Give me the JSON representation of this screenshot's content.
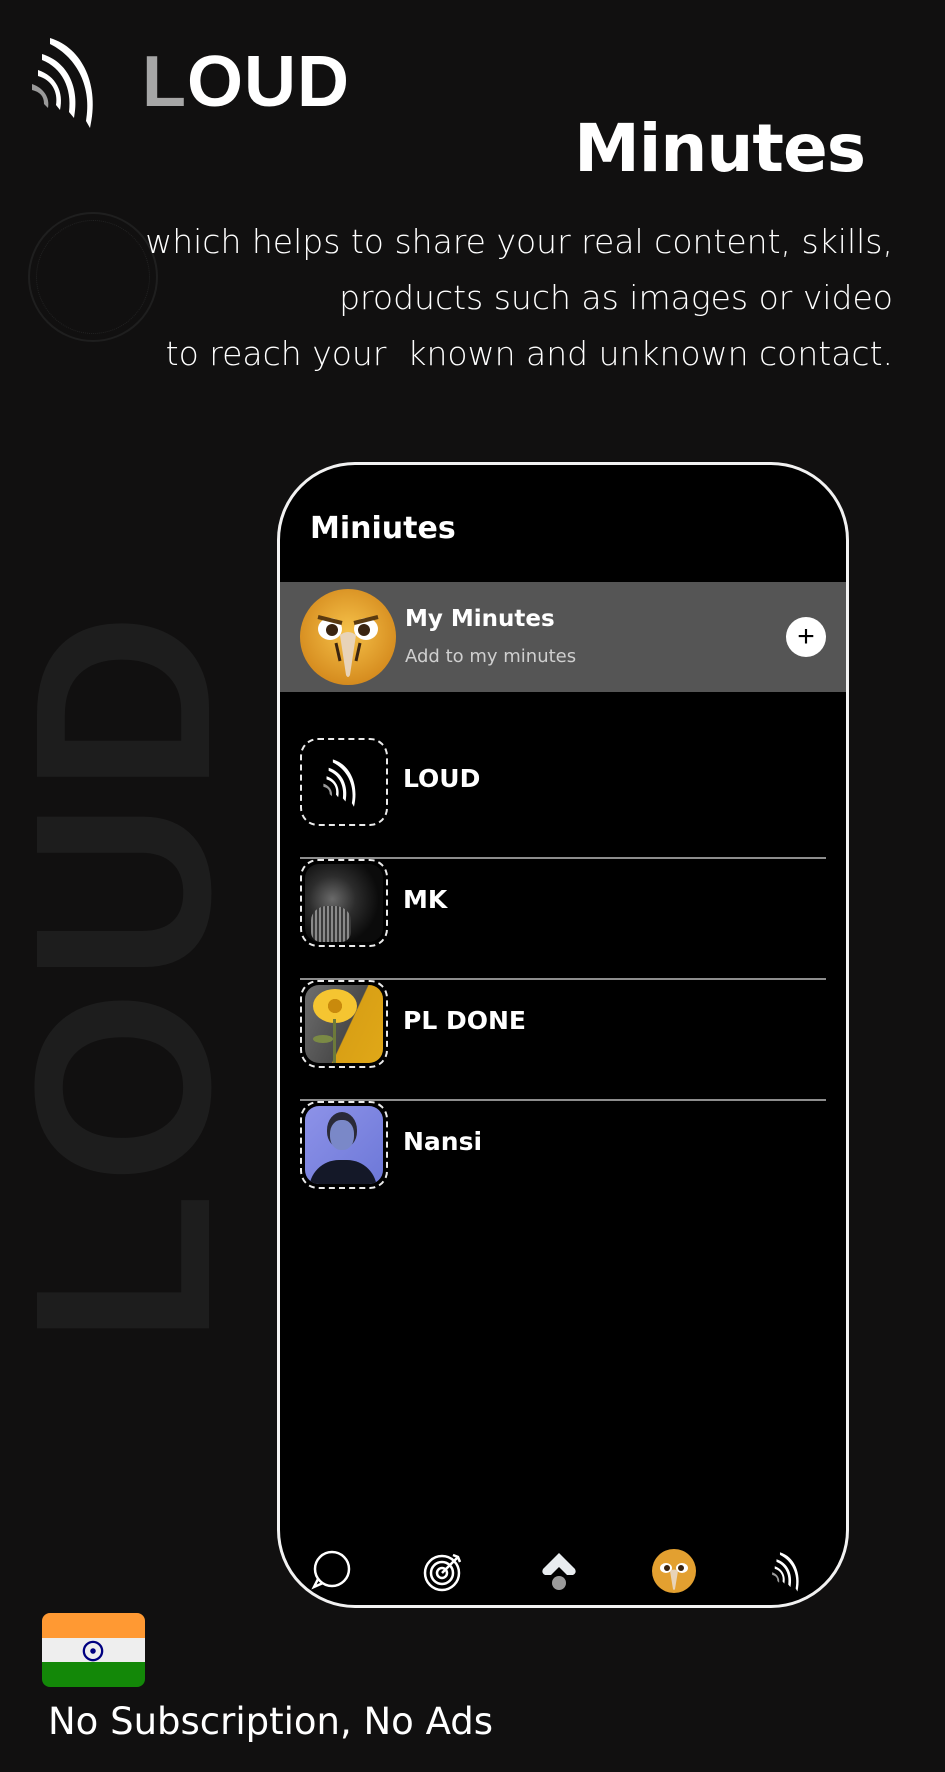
{
  "brand": {
    "logo_icon": "loud-waves-icon",
    "name_first_letter": "L",
    "name_rest": "OUD",
    "watermark": "LOUD"
  },
  "hero": {
    "title": "Minutes",
    "description_lines": [
      "which helps to share your real content, skills,",
      "products such as images or video",
      "to reach your  known and unknown contact."
    ]
  },
  "phone": {
    "screen_title": "Miniutes",
    "my_minutes": {
      "avatar": "eagle-avatar",
      "title": "My Minutes",
      "subtitle": "Add to my minutes",
      "add_icon": "plus-icon"
    },
    "contacts": [
      {
        "name": "LOUD",
        "thumbnail": "loud-logo-thumbnail"
      },
      {
        "name": "MK",
        "thumbnail": "old-man-portrait-thumbnail"
      },
      {
        "name": "PL DONE",
        "thumbnail": "sunflower-thumbnail"
      },
      {
        "name": "Nansi",
        "thumbnail": "woman-portrait-thumbnail"
      }
    ],
    "bottom_nav": [
      {
        "icon": "chat-bubble-icon"
      },
      {
        "icon": "target-icon"
      },
      {
        "icon": "upload-home-icon",
        "active": true
      },
      {
        "icon": "profile-avatar-icon"
      },
      {
        "icon": "loud-waves-icon"
      }
    ]
  },
  "footer": {
    "flag": "india-flag",
    "text": "No Subscription, No Ads"
  },
  "colors": {
    "background": "#111010",
    "phone_screen": "#000000",
    "my_minutes_row": "#555555",
    "flag_saffron": "#ff9933",
    "flag_white": "#eeeeee",
    "flag_green": "#138808",
    "flag_chakra": "#000080"
  }
}
